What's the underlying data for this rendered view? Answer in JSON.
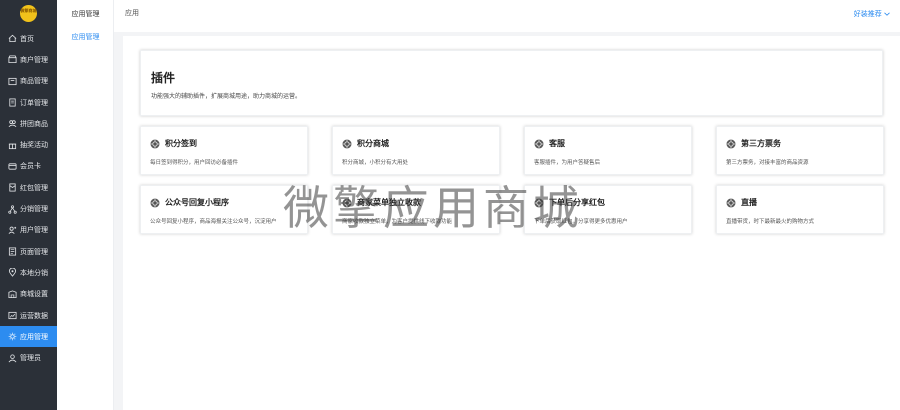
{
  "logo": {
    "text": "微擎商城"
  },
  "sidebar": {
    "items": [
      {
        "label": "首页",
        "icon": "home-icon"
      },
      {
        "label": "商户管理",
        "icon": "store-icon"
      },
      {
        "label": "商品管理",
        "icon": "goods-icon"
      },
      {
        "label": "订单管理",
        "icon": "order-icon"
      },
      {
        "label": "拼团商品",
        "icon": "group-buy-icon"
      },
      {
        "label": "抽奖活动",
        "icon": "lottery-icon"
      },
      {
        "label": "会员卡",
        "icon": "member-card-icon"
      },
      {
        "label": "红包管理",
        "icon": "red-packet-icon"
      },
      {
        "label": "分销管理",
        "icon": "distribution-icon"
      },
      {
        "label": "用户管理",
        "icon": "user-icon"
      },
      {
        "label": "页面管理",
        "icon": "page-icon"
      },
      {
        "label": "本地分销",
        "icon": "location-icon"
      },
      {
        "label": "商城设置",
        "icon": "settings-icon"
      },
      {
        "label": "运营数据",
        "icon": "data-icon"
      },
      {
        "label": "应用管理",
        "icon": "app-icon",
        "active": true
      },
      {
        "label": "管理员",
        "icon": "admin-icon"
      }
    ]
  },
  "subnav": {
    "title": "应用管理",
    "item": "应用管理"
  },
  "topbar": {
    "breadcrumb": "应用",
    "good_recommend": "好装推荐"
  },
  "banner": {
    "title": "插件",
    "desc": "功能强大的辅助插件，扩展商城用途，助力商城的运营。"
  },
  "plugins": [
    {
      "name": "积分签到",
      "desc": "每日签到得积分，用户回访必备插件"
    },
    {
      "name": "积分商城",
      "desc": "积分商城，小积分有大用处"
    },
    {
      "name": "客服",
      "desc": "客服插件，为用户答疑售后"
    },
    {
      "name": "第三方票务",
      "desc": "第三方票务，对接丰富的商品资源"
    },
    {
      "name": "公众号回复小程序",
      "desc": "公众号回复小程序，商品海报关注公众号，沉淀用户"
    },
    {
      "name": "商家菜单独立收款",
      "desc": "商家收款独立菜单，为客户提供线下收款功能"
    },
    {
      "name": "下单后分享红包",
      "desc": "下单后获取红包，分享得更多优惠用户"
    },
    {
      "name": "直播",
      "desc": "直播带货，时下最新最火的购物方式"
    }
  ],
  "watermark": "微擎应用商城",
  "colors": {
    "sidebar_bg": "#2b3038",
    "accent": "#2d8cf0"
  }
}
